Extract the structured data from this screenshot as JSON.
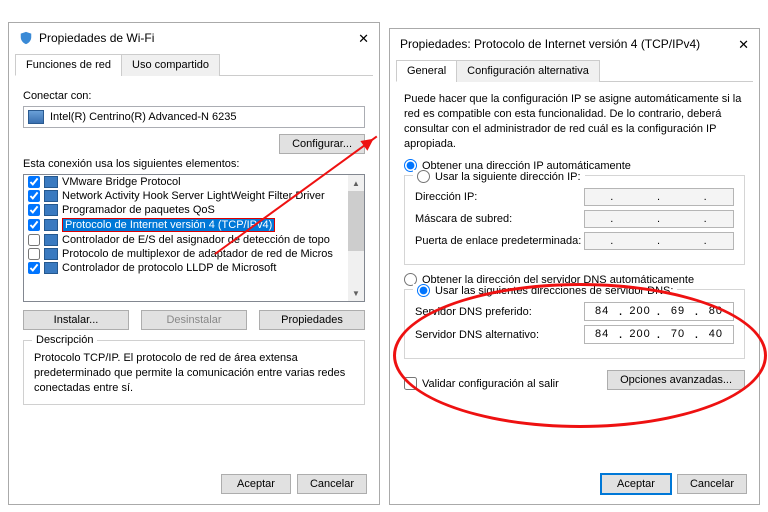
{
  "left": {
    "title": "Propiedades de Wi-Fi",
    "tabs": {
      "network": "Funciones de red",
      "sharing": "Uso compartido"
    },
    "connect_label": "Conectar con:",
    "adapter": "Intel(R) Centrino(R) Advanced-N 6235",
    "configure_btn": "Configurar...",
    "elements_label": "Esta conexión usa los siguientes elementos:",
    "items": [
      {
        "checked": true,
        "label": "VMware Bridge Protocol"
      },
      {
        "checked": true,
        "label": "Network Activity Hook Server LightWeight Filter Driver"
      },
      {
        "checked": true,
        "label": "Programador de paquetes QoS"
      },
      {
        "checked": true,
        "label": "Protocolo de Internet versión 4 (TCP/IPv4)",
        "selected": true
      },
      {
        "checked": false,
        "label": "Controlador de E/S del asignador de detección de topo"
      },
      {
        "checked": false,
        "label": "Protocolo de multiplexor de adaptador de red de Micros"
      },
      {
        "checked": true,
        "label": "Controlador de protocolo LLDP de Microsoft"
      }
    ],
    "install_btn": "Instalar...",
    "uninstall_btn": "Desinstalar",
    "properties_btn": "Propiedades",
    "desc_legend": "Descripción",
    "desc_text": "Protocolo TCP/IP. El protocolo de red de área extensa predeterminado que permite la comunicación entre varias redes conectadas entre sí.",
    "ok": "Aceptar",
    "cancel": "Cancelar"
  },
  "right": {
    "title": "Propiedades: Protocolo de Internet versión 4 (TCP/IPv4)",
    "tabs": {
      "general": "General",
      "alt": "Configuración alternativa"
    },
    "info": "Puede hacer que la configuración IP se asigne automáticamente si la red es compatible con esta funcionalidad. De lo contrario, deberá consultar con el administrador de red cuál es la configuración IP apropiada.",
    "ip_auto": "Obtener una dirección IP automáticamente",
    "ip_manual": "Usar la siguiente dirección IP:",
    "ip_addr": "Dirección IP:",
    "subnet": "Máscara de subred:",
    "gateway": "Puerta de enlace predeterminada:",
    "dns_auto": "Obtener la dirección del servidor DNS automáticamente",
    "dns_manual": "Usar las siguientes direcciones de servidor DNS:",
    "dns_pref_label": "Servidor DNS preferido:",
    "dns_pref": [
      "84",
      "200",
      "69",
      "80"
    ],
    "dns_alt_label": "Servidor DNS alternativo:",
    "dns_alt": [
      "84",
      "200",
      "70",
      "40"
    ],
    "validate": "Validar configuración al salir",
    "advanced": "Opciones avanzadas...",
    "ok": "Aceptar",
    "cancel": "Cancelar"
  }
}
